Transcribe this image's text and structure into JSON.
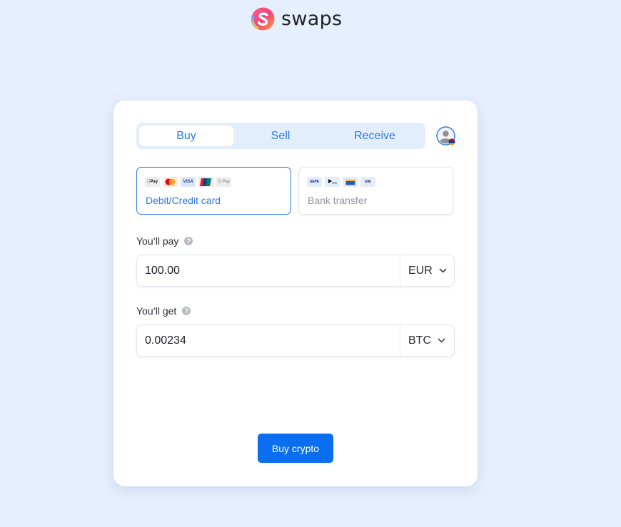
{
  "brand": {
    "name": "swaps",
    "logo_icon": "swaps-logo-icon"
  },
  "tabs": [
    {
      "label": "Buy",
      "active": true
    },
    {
      "label": "Sell",
      "active": false
    },
    {
      "label": "Receive",
      "active": false
    }
  ],
  "profile": {
    "icon": "user-avatar-icon",
    "flag": "armenia-flag"
  },
  "payment_methods": [
    {
      "label": "Debit/Credit card",
      "selected": true,
      "icons": [
        "apple-pay",
        "mastercard",
        "visa",
        "unionpay",
        "google-pay"
      ],
      "icon_text": [
        "Pay",
        "",
        "VISA",
        "",
        "G Pay"
      ]
    },
    {
      "label": "Bank transfer",
      "selected": false,
      "icons": [
        "sepa",
        "faster-payments",
        "card",
        "blik"
      ],
      "icon_text": [
        "SEPA",
        "",
        "",
        "blik"
      ]
    }
  ],
  "pay": {
    "label": "You’ll pay",
    "value": "100.00",
    "currency": "EUR"
  },
  "get": {
    "label": "You’ll get",
    "value": "0.00234",
    "currency": "BTC"
  },
  "help_glyph": "?",
  "submit": {
    "label": "Buy crypto"
  },
  "colors": {
    "accent": "#2a7be4",
    "button": "#0a6ef0",
    "background": "#e6effd"
  }
}
